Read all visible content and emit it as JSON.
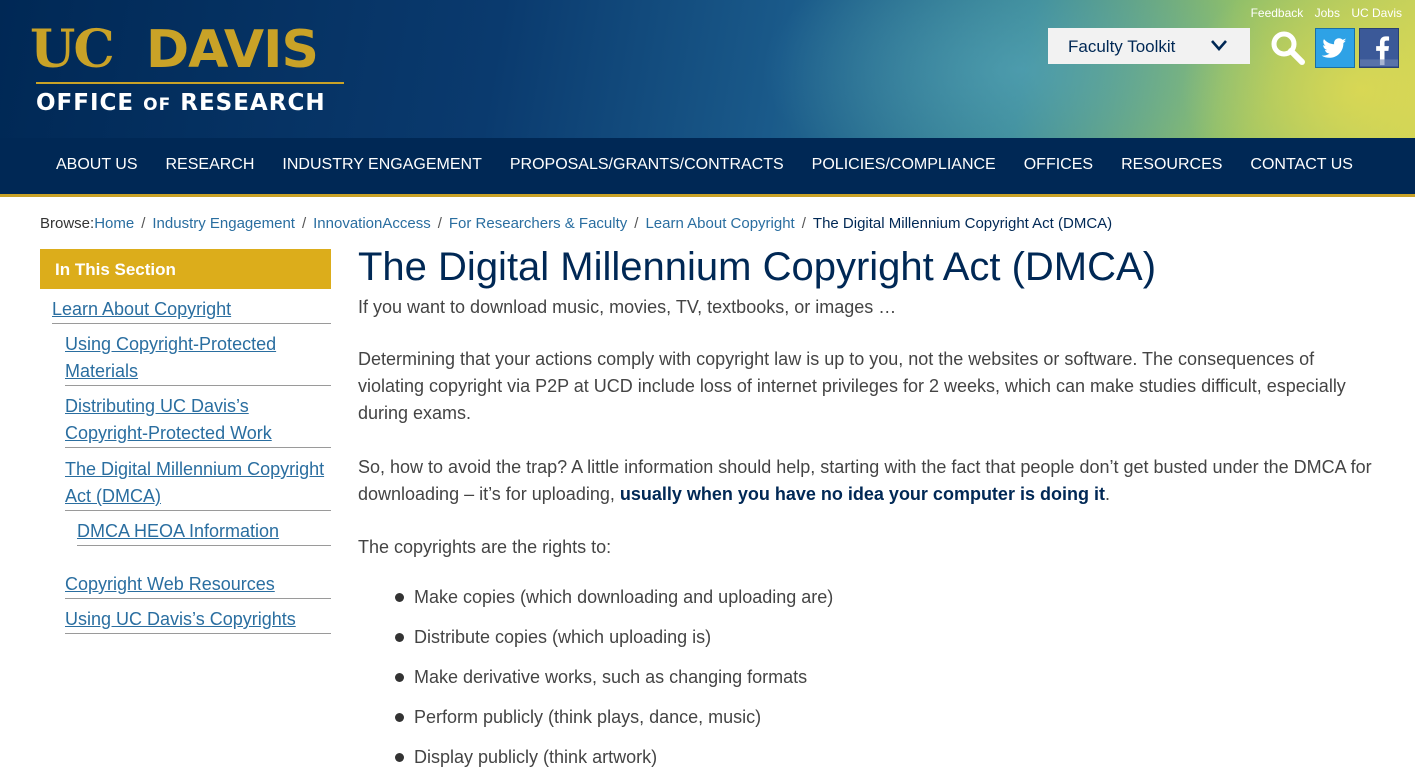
{
  "header": {
    "logo": {
      "uc": "UC",
      "davis": "DAVIS",
      "office": "OFFICE",
      "of": "OF",
      "research": "RESEARCH"
    },
    "utility_links": [
      "Feedback",
      "Jobs",
      "UC Davis"
    ],
    "toolkit_label": "Faculty Toolkit",
    "icons": [
      "search-icon",
      "twitter-icon",
      "facebook-icon"
    ]
  },
  "nav": {
    "items": [
      "ABOUT US",
      "RESEARCH",
      "INDUSTRY ENGAGEMENT",
      "PROPOSALS/GRANTS/CONTRACTS",
      "POLICIES/COMPLIANCE",
      "OFFICES",
      "RESOURCES",
      "CONTACT US"
    ]
  },
  "breadcrumb": {
    "lead": "Browse:",
    "items": [
      "Home",
      "Industry Engagement",
      "InnovationAccess",
      "For Researchers & Faculty",
      "Learn About Copyright"
    ],
    "current": "The Digital Millennium Copyright Act (DMCA)"
  },
  "sidebar": {
    "heading": "In This Section",
    "items": [
      {
        "label": "Learn About Copyright"
      },
      {
        "label": "Using Copyright-Protected Materials"
      },
      {
        "label": "Distributing UC Davis’s Copyright-Protected Work"
      },
      {
        "label": "The Digital Millennium Copyright Act (DMCA)"
      },
      {
        "label": "DMCA HEOA Information"
      },
      {
        "label": "Copyright Web Resources"
      },
      {
        "label": "Using UC Davis’s Copyrights"
      }
    ]
  },
  "main": {
    "title": "The Digital Millennium Copyright Act (DMCA)",
    "intro": "If you want to download music, movies, TV, textbooks, or images …",
    "para1": "Determining that your actions comply with copyright law is up to you, not the websites or software. The consequences of violating copyright via P2P at UCD include loss of internet privileges for 2 weeks, which can make studies difficult, especially during exams.",
    "para2_start": "So, how to avoid the trap? A little information should help, starting with the fact that people don’t get busted under the DMCA for downloading – it’s for uploading, ",
    "para2_bold": "usually when you have no idea your computer is doing it",
    "para2_end": ".",
    "para3": "The copyrights are the rights to:",
    "rights": [
      "Make copies (which downloading and uploading are)",
      "Distribute copies (which uploading is)",
      "Make derivative works, such as changing formats",
      "Perform publicly (think plays, dance, music)",
      "Display publicly (think artwork)"
    ]
  },
  "colors": {
    "navy": "#002855",
    "gold": "#c9a227",
    "link": "#2a6ea0",
    "sidebar_head": "#dcad1b"
  }
}
